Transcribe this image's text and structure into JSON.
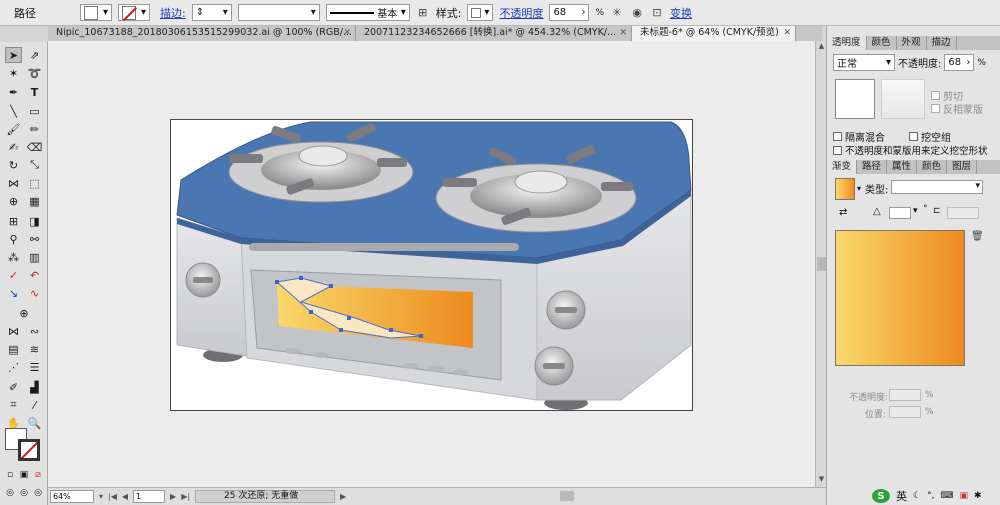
{
  "control_bar": {
    "object_type": "路径",
    "stroke_link": "描边:",
    "stroke_profile": "基本",
    "style_label": "样式:",
    "opacity_link": "不透明度",
    "opacity_value": "68",
    "opacity_unit": "%",
    "transform_link": "变换"
  },
  "tabs": [
    {
      "label": "Nipic_10673188_20180306153515299032.ai @ 100% (RGB/..."
    },
    {
      "label": "20071123234652666 [转换].ai* @ 454.32% (CMYK/..."
    },
    {
      "label": "未标题-6* @ 64% (CMYK/预览)"
    }
  ],
  "status_bar": {
    "zoom": "64%",
    "page": "1",
    "message": "25 次还原; 无重做"
  },
  "transparency_panel": {
    "tabs": [
      "透明度",
      "颜色",
      "外观",
      "描边"
    ],
    "blend_mode": "正常",
    "opacity_label": "不透明度:",
    "opacity_value": "68",
    "opacity_unit": "%",
    "clip_label": "剪切",
    "invert_mask_label": "反相蒙版",
    "isolate_blend_label": "隔离混合",
    "knockout_label": "挖空组",
    "opacity_mask_label": "不透明度和蒙版用来定义挖空形状"
  },
  "gradient_panel": {
    "tabs": [
      "渐变",
      "路径",
      "属性",
      "颜色",
      "图层"
    ],
    "type_label": "类型:",
    "type_value": "",
    "angle_unit": "°",
    "stop_opacity_label": "不透明度:",
    "location_label": "位置:",
    "percent": "%"
  },
  "colors": {
    "stove_top": "#4a76b2",
    "gradient_start": "#f8d96a",
    "gradient_end": "#ee8a1e"
  },
  "ime": {
    "language": "英"
  }
}
